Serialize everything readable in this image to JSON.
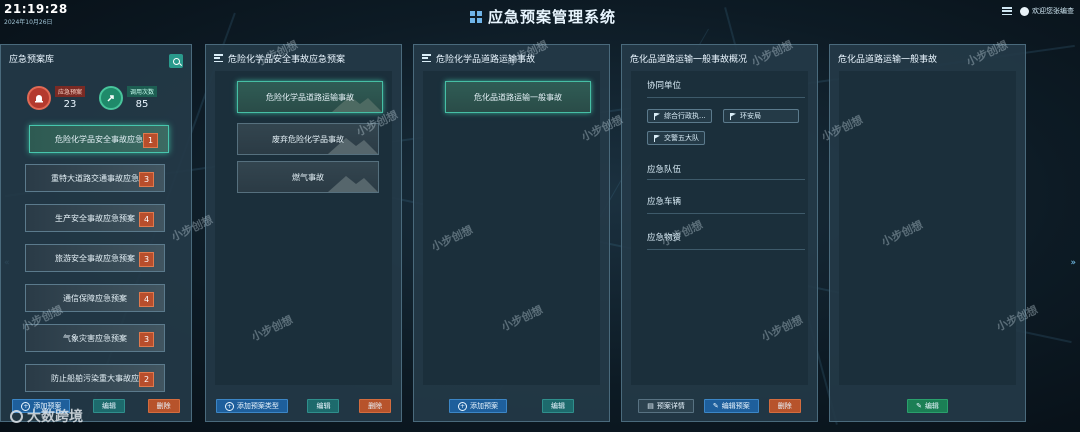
{
  "clock": {
    "time": "21:19:28",
    "date": "2024年10月26日"
  },
  "header": {
    "title": "应急预案管理系统",
    "user": "欢迎您张编查"
  },
  "colors": {
    "accent": "#47c6ad",
    "badge": "#b84e2c",
    "blue_btn": "#1e5f9c",
    "orange_btn": "#b7532b",
    "green_btn": "#1b7f55"
  },
  "library": {
    "title": "应急预案库",
    "stats": [
      {
        "label": "应急预案",
        "value": "23",
        "icon": "alarm-icon"
      },
      {
        "label": "调用次数",
        "value": "85",
        "icon": "share-icon"
      }
    ],
    "items": [
      {
        "label": "危险化学品安全事故应急",
        "count": "1"
      },
      {
        "label": "重特大道路交通事故应急",
        "count": "3"
      },
      {
        "label": "生产安全事故应急预案",
        "count": "4"
      },
      {
        "label": "旅游安全事故应急预案",
        "count": "3"
      },
      {
        "label": "通信保障应急预案",
        "count": "4"
      },
      {
        "label": "气象灾害应急预案",
        "count": "3"
      },
      {
        "label": "防止船舶污染重大事故应",
        "count": "2"
      }
    ],
    "buttons": {
      "add": "添加预案",
      "edit": "编辑",
      "delete": "删除"
    }
  },
  "panel2": {
    "title": "危险化学品安全事故应急预案",
    "items": [
      "危险化学品道路运输事故",
      "废弃危险化学品事故",
      "燃气事故"
    ],
    "buttons": {
      "add": "添加预案类型",
      "edit": "编辑",
      "delete": "删除"
    }
  },
  "panel3": {
    "title": "危险化学品道路运输事故",
    "items": [
      "危化品道路运输一般事故"
    ],
    "buttons": {
      "add": "添加预案",
      "edit": "编辑"
    }
  },
  "panel4": {
    "title": "危化品道路运输一般事故概况",
    "sections": {
      "units": "协同单位",
      "team": "应急队伍",
      "vehicles": "应急车辆",
      "materials": "应急物资"
    },
    "tags": [
      "综合行政执...",
      "环安局",
      "交警五大队"
    ],
    "buttons": {
      "detail": "预案详情",
      "edit": "编辑预案",
      "delete": "删除"
    }
  },
  "panel5": {
    "title": "危化品道路运输一般事故",
    "buttons": {
      "edit": "编辑"
    }
  },
  "watermarks": {
    "text": "小步创想",
    "brand": "大数跨境"
  }
}
